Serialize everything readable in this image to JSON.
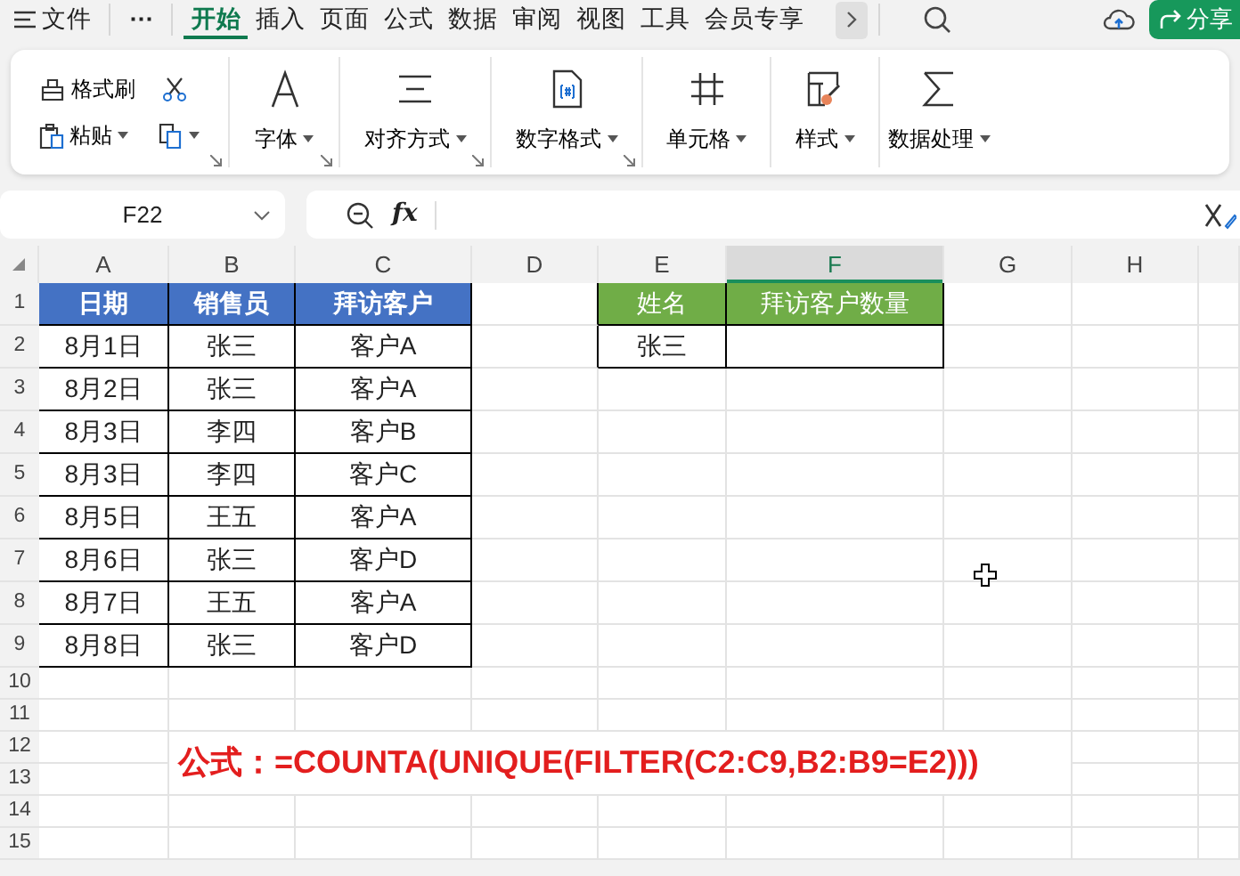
{
  "menu_bar": {
    "file_label": "文件",
    "more_label": "⋯",
    "tabs": [
      {
        "label": "开始",
        "selected": true
      },
      {
        "label": "插入",
        "selected": false
      },
      {
        "label": "页面",
        "selected": false
      },
      {
        "label": "公式",
        "selected": false
      },
      {
        "label": "数据",
        "selected": false
      },
      {
        "label": "审阅",
        "selected": false
      },
      {
        "label": "视图",
        "selected": false
      },
      {
        "label": "工具",
        "selected": false
      },
      {
        "label": "会员专享",
        "selected": false
      }
    ],
    "share_button": "分享"
  },
  "ribbon": {
    "groups": [
      {
        "kind": "clipboard",
        "items": [
          "格式刷",
          "粘贴"
        ],
        "launcher": true
      },
      {
        "kind": "large",
        "label": "字体",
        "launcher": true
      },
      {
        "kind": "large",
        "label": "对齐方式",
        "launcher": true
      },
      {
        "kind": "large",
        "label": "数字格式",
        "launcher": true
      },
      {
        "kind": "large",
        "label": "单元格"
      },
      {
        "kind": "large",
        "label": "样式"
      },
      {
        "kind": "large",
        "label": "数据处理"
      }
    ]
  },
  "formula_bar": {
    "name_box": "F22",
    "fx_label": "fx"
  },
  "sheet": {
    "columns": [
      {
        "label": "A",
        "selected": false
      },
      {
        "label": "B",
        "selected": false
      },
      {
        "label": "C",
        "selected": false
      },
      {
        "label": "D",
        "selected": false
      },
      {
        "label": "E",
        "selected": false
      },
      {
        "label": "F",
        "selected": true
      },
      {
        "label": "G",
        "selected": false
      },
      {
        "label": "H",
        "selected": false
      }
    ],
    "rows": [
      {
        "number": "1",
        "cells": [
          {
            "kind": "header",
            "color": "#4472c4",
            "text": "日期"
          },
          {
            "kind": "header",
            "color": "#4472c4",
            "text": "销售员"
          },
          {
            "kind": "header",
            "color": "#4472c4",
            "text": "拜访客户"
          },
          {
            "kind": "plain"
          },
          {
            "kind": "header",
            "color": "#70ad47",
            "text": "姓名"
          },
          {
            "kind": "header",
            "color": "#70ad47",
            "text": "拜访客户数量"
          }
        ]
      },
      {
        "number": "2",
        "cells": [
          {
            "kind": "body",
            "text": "8月1日"
          },
          {
            "kind": "body",
            "text": "张三"
          },
          {
            "kind": "body",
            "text": "客户A"
          },
          {
            "kind": "plain"
          },
          {
            "kind": "body",
            "text": "张三"
          },
          {
            "kind": "body"
          }
        ]
      },
      {
        "number": "3",
        "cells": [
          {
            "kind": "body",
            "text": "8月2日"
          },
          {
            "kind": "body",
            "text": "张三"
          },
          {
            "kind": "body",
            "text": "客户A"
          }
        ]
      },
      {
        "number": "4",
        "cells": [
          {
            "kind": "body",
            "text": "8月3日"
          },
          {
            "kind": "body",
            "text": "李四"
          },
          {
            "kind": "body",
            "text": "客户B"
          }
        ]
      },
      {
        "number": "5",
        "cells": [
          {
            "kind": "body",
            "text": "8月3日"
          },
          {
            "kind": "body",
            "text": "李四"
          },
          {
            "kind": "body",
            "text": "客户C"
          }
        ]
      },
      {
        "number": "6",
        "cells": [
          {
            "kind": "body",
            "text": "8月5日"
          },
          {
            "kind": "body",
            "text": "王五"
          },
          {
            "kind": "body",
            "text": "客户A"
          }
        ]
      },
      {
        "number": "7",
        "cells": [
          {
            "kind": "body",
            "text": "8月6日"
          },
          {
            "kind": "body",
            "text": "张三"
          },
          {
            "kind": "body",
            "text": "客户D"
          }
        ]
      },
      {
        "number": "8",
        "cells": [
          {
            "kind": "body",
            "text": "8月7日"
          },
          {
            "kind": "body",
            "text": "王五"
          },
          {
            "kind": "body",
            "text": "客户A"
          }
        ]
      },
      {
        "number": "9",
        "cells": [
          {
            "kind": "body",
            "text": "8月8日"
          },
          {
            "kind": "body",
            "text": "张三"
          },
          {
            "kind": "body",
            "text": "客户D"
          }
        ]
      },
      {
        "number": "10"
      },
      {
        "number": "11"
      },
      {
        "number": "12"
      },
      {
        "number": "13"
      },
      {
        "number": "14"
      },
      {
        "number": "15"
      }
    ],
    "formula_note": "公式：=COUNTA(UNIQUE(FILTER(C2:C9,B2:B9=E2)))"
  }
}
